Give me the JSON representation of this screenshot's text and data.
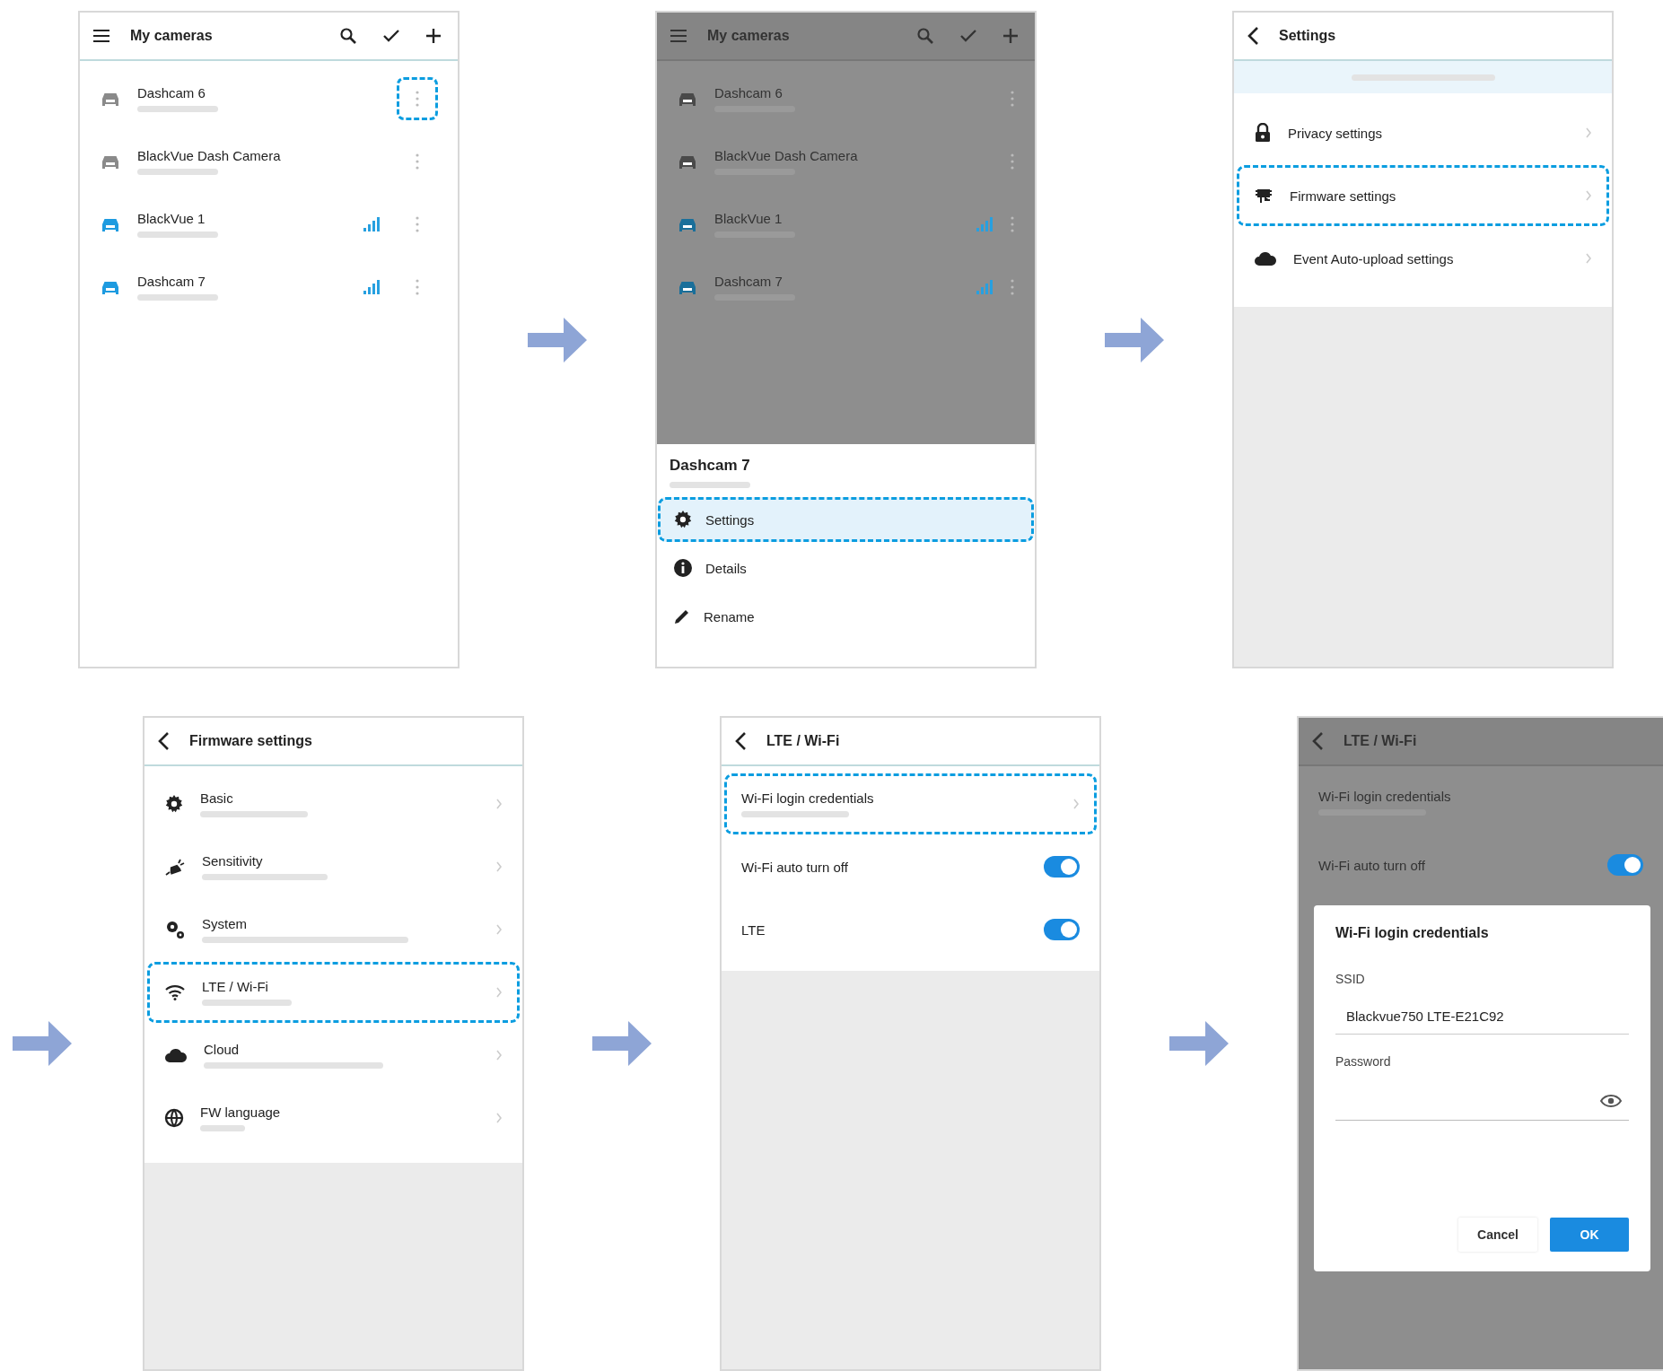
{
  "steps": [
    {
      "kind": "camera_list",
      "title": "My cameras",
      "cameras": [
        {
          "name": "Dashcam 6",
          "connected": false,
          "menu_highlighted": true
        },
        {
          "name": "BlackVue Dash Camera",
          "connected": false,
          "menu_highlighted": false
        },
        {
          "name": "BlackVue 1",
          "connected": true,
          "menu_highlighted": false
        },
        {
          "name": "Dashcam 7",
          "connected": true,
          "menu_highlighted": false
        }
      ]
    },
    {
      "kind": "camera_menu",
      "title": "My cameras",
      "cameras": [
        {
          "name": "Dashcam 6",
          "connected": false
        },
        {
          "name": "BlackVue Dash Camera",
          "connected": false
        },
        {
          "name": "BlackVue 1",
          "connected": true
        },
        {
          "name": "Dashcam 7",
          "connected": true
        }
      ],
      "sheet": {
        "title": "Dashcam 7",
        "actions": [
          {
            "label": "Settings",
            "highlighted": true
          },
          {
            "label": "Details",
            "highlighted": false
          },
          {
            "label": "Rename",
            "highlighted": false
          }
        ]
      }
    },
    {
      "kind": "settings",
      "title": "Settings",
      "items": [
        {
          "label": "Privacy settings",
          "highlighted": false
        },
        {
          "label": "Firmware settings",
          "highlighted": true
        },
        {
          "label": "Event Auto-upload settings",
          "highlighted": false
        }
      ]
    },
    {
      "kind": "firmware_settings",
      "title": "Firmware settings",
      "items": [
        {
          "label": "Basic",
          "highlighted": false
        },
        {
          "label": "Sensitivity",
          "highlighted": false
        },
        {
          "label": "System",
          "highlighted": false
        },
        {
          "label": "LTE / Wi-Fi",
          "highlighted": true
        },
        {
          "label": "Cloud",
          "highlighted": false
        },
        {
          "label": "FW language",
          "highlighted": false
        }
      ]
    },
    {
      "kind": "lte_wifi",
      "title": "LTE / Wi-Fi",
      "items": [
        {
          "kind": "link",
          "label": "Wi-Fi login credentials",
          "highlighted": true
        },
        {
          "kind": "toggle",
          "label": "Wi-Fi auto turn off",
          "on": true
        },
        {
          "kind": "toggle",
          "label": "LTE",
          "on": true
        }
      ]
    },
    {
      "kind": "credentials_dialog",
      "title": "LTE / Wi-Fi",
      "items": [
        {
          "kind": "link",
          "label": "Wi-Fi login credentials"
        },
        {
          "kind": "toggle",
          "label": "Wi-Fi auto turn off",
          "on": true
        }
      ],
      "dialog": {
        "title": "Wi-Fi login credentials",
        "ssid_label": "SSID",
        "ssid_value": "Blackvue750 LTE-E21C92",
        "password_label": "Password",
        "buttons": [
          "Cancel",
          "OK"
        ]
      }
    }
  ]
}
